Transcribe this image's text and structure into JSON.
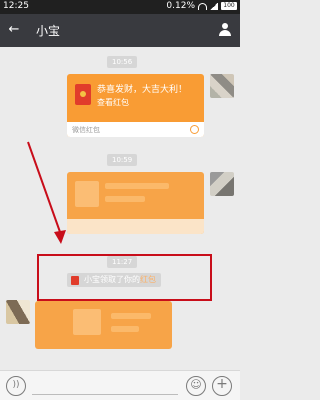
{
  "status_bar": {
    "time": "12:25",
    "battery_percent": "0.12%",
    "battery_level": "100"
  },
  "header": {
    "title": "小宝",
    "back_icon": "back-arrow-icon",
    "contact_icon": "person-icon"
  },
  "messages": {
    "time_1": "10:56",
    "redpacket_greeting": "恭喜发财，大吉大利！",
    "redpacket_action": "查看红包",
    "redpacket_footer": "微信红包",
    "time_2": "10:59",
    "time_3": "11:27",
    "notice_prefix": "小宝领取了你的",
    "notice_link": "红包"
  },
  "colors": {
    "redpacket_orange": "#f99c34",
    "header_bg": "#393a3f",
    "highlight_box": "#c80d1a"
  }
}
